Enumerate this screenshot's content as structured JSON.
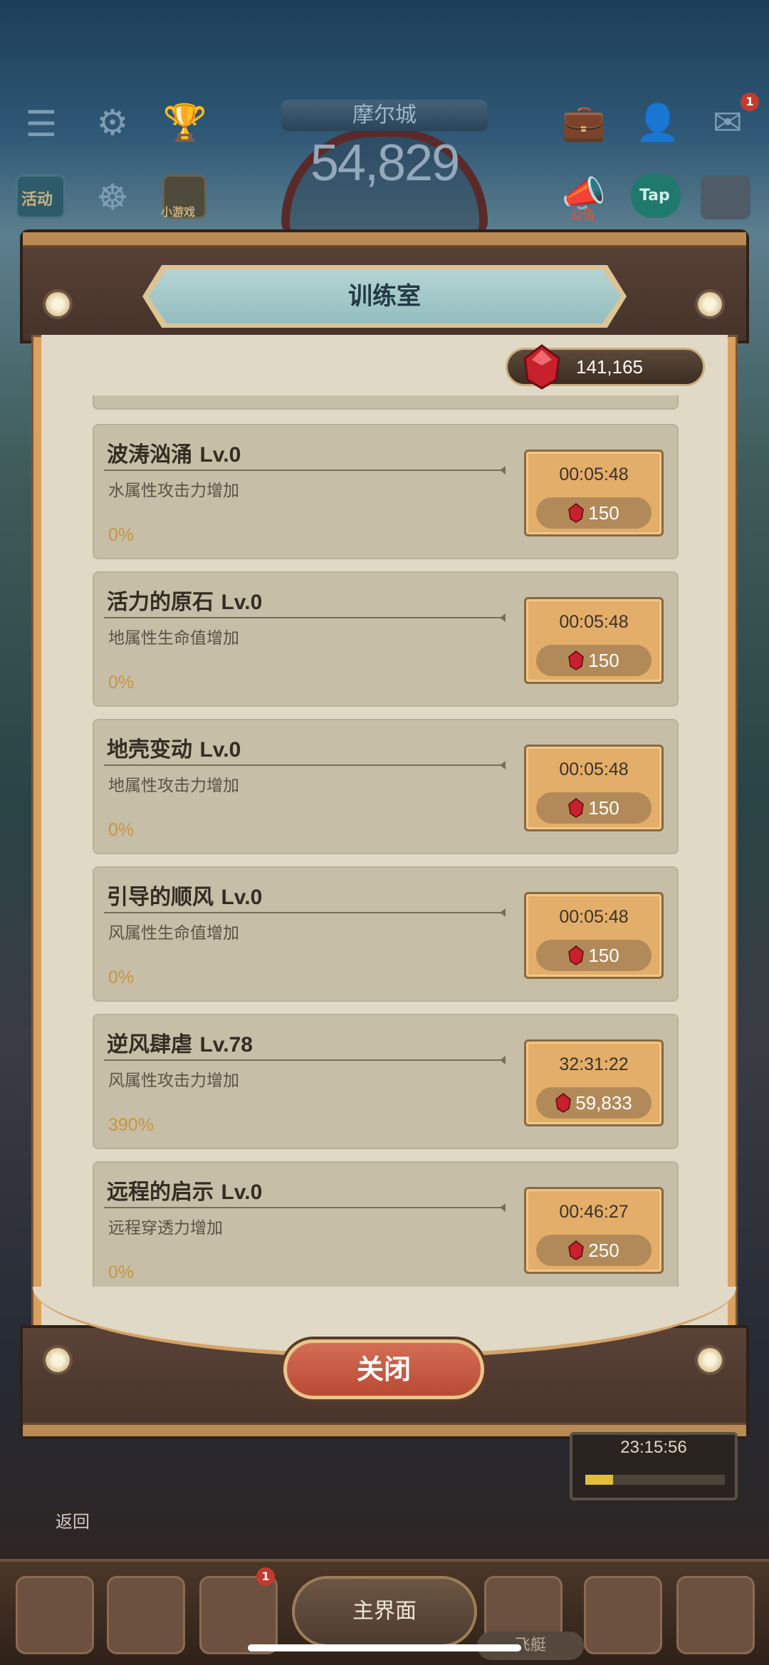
{
  "hud": {
    "city_name": "摩尔城",
    "power": "54,829",
    "activity_label": "活动",
    "minigame_label": "小游戏",
    "notice_label": "公告",
    "tap_label": "Tap",
    "mail_badge": "1"
  },
  "panel": {
    "title": "训练室",
    "gem_balance": "141,165",
    "close_label": "关闭"
  },
  "trainings": [
    {
      "name": "波涛汹涌",
      "level": "Lv.0",
      "desc": "水属性攻击力增加",
      "percent": "0%",
      "time": "00:05:48",
      "cost": "150"
    },
    {
      "name": "活力的原石",
      "level": "Lv.0",
      "desc": "地属性生命值增加",
      "percent": "0%",
      "time": "00:05:48",
      "cost": "150"
    },
    {
      "name": "地壳变动",
      "level": "Lv.0",
      "desc": "地属性攻击力增加",
      "percent": "0%",
      "time": "00:05:48",
      "cost": "150"
    },
    {
      "name": "引导的顺风",
      "level": "Lv.0",
      "desc": "风属性生命值增加",
      "percent": "0%",
      "time": "00:05:48",
      "cost": "150"
    },
    {
      "name": "逆风肆虐",
      "level": "Lv.78",
      "desc": "风属性攻击力增加",
      "percent": "390%",
      "time": "32:31:22",
      "cost": "59,833"
    },
    {
      "name": "远程的启示",
      "level": "Lv.0",
      "desc": "远程穿透力增加",
      "percent": "0%",
      "time": "00:46:27",
      "cost": "250"
    }
  ],
  "scene": {
    "timer": "23:15:56",
    "timer_progress": 0.2,
    "back_label": "返回"
  },
  "nav": {
    "home_label": "主界面",
    "ship_label": "飞艇",
    "badge": "1"
  },
  "colors": {
    "accent_gem": "#c8202c",
    "percent_gold": "#c69542",
    "button_tan": "#e3ae69"
  }
}
